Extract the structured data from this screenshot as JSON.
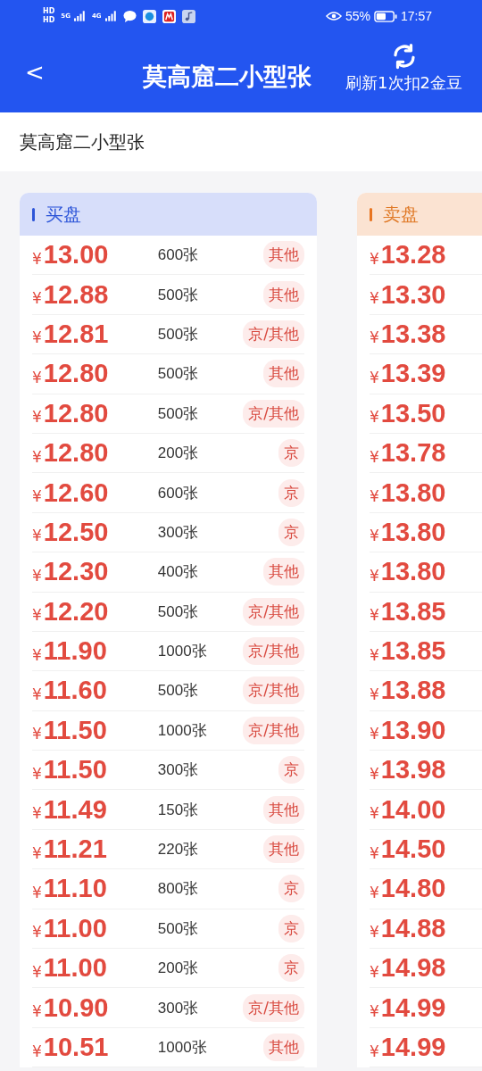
{
  "status_bar": {
    "sim_labels": [
      "HD",
      "HD"
    ],
    "networks": [
      "5G",
      "4G"
    ],
    "battery_text": "55%",
    "time": "17:57"
  },
  "header": {
    "back": "<",
    "title": "莫高窟二小型张",
    "refresh_note": "刷新1次扣2金豆"
  },
  "subtitle": "莫高窟二小型张",
  "buy": {
    "title": "买盘",
    "rows": [
      {
        "currency": "¥",
        "price": "13.00",
        "qty": "600张",
        "tag": "其他"
      },
      {
        "currency": "¥",
        "price": "12.88",
        "qty": "500张",
        "tag": "其他"
      },
      {
        "currency": "¥",
        "price": "12.81",
        "qty": "500张",
        "tag": "京/其他"
      },
      {
        "currency": "¥",
        "price": "12.80",
        "qty": "500张",
        "tag": "其他"
      },
      {
        "currency": "¥",
        "price": "12.80",
        "qty": "500张",
        "tag": "京/其他"
      },
      {
        "currency": "¥",
        "price": "12.80",
        "qty": "200张",
        "tag": "京"
      },
      {
        "currency": "¥",
        "price": "12.60",
        "qty": "600张",
        "tag": "京"
      },
      {
        "currency": "¥",
        "price": "12.50",
        "qty": "300张",
        "tag": "京"
      },
      {
        "currency": "¥",
        "price": "12.30",
        "qty": "400张",
        "tag": "其他"
      },
      {
        "currency": "¥",
        "price": "12.20",
        "qty": "500张",
        "tag": "京/其他"
      },
      {
        "currency": "¥",
        "price": "11.90",
        "qty": "1000张",
        "tag": "京/其他"
      },
      {
        "currency": "¥",
        "price": "11.60",
        "qty": "500张",
        "tag": "京/其他"
      },
      {
        "currency": "¥",
        "price": "11.50",
        "qty": "1000张",
        "tag": "京/其他"
      },
      {
        "currency": "¥",
        "price": "11.50",
        "qty": "300张",
        "tag": "京"
      },
      {
        "currency": "¥",
        "price": "11.49",
        "qty": "150张",
        "tag": "其他"
      },
      {
        "currency": "¥",
        "price": "11.21",
        "qty": "220张",
        "tag": "其他"
      },
      {
        "currency": "¥",
        "price": "11.10",
        "qty": "800张",
        "tag": "京"
      },
      {
        "currency": "¥",
        "price": "11.00",
        "qty": "500张",
        "tag": "京"
      },
      {
        "currency": "¥",
        "price": "11.00",
        "qty": "200张",
        "tag": "京"
      },
      {
        "currency": "¥",
        "price": "10.90",
        "qty": "300张",
        "tag": "京/其他"
      },
      {
        "currency": "¥",
        "price": "10.51",
        "qty": "1000张",
        "tag": "其他"
      }
    ]
  },
  "sell": {
    "title": "卖盘",
    "rows": [
      {
        "currency": "¥",
        "price": "13.28"
      },
      {
        "currency": "¥",
        "price": "13.30"
      },
      {
        "currency": "¥",
        "price": "13.38"
      },
      {
        "currency": "¥",
        "price": "13.39"
      },
      {
        "currency": "¥",
        "price": "13.50"
      },
      {
        "currency": "¥",
        "price": "13.78"
      },
      {
        "currency": "¥",
        "price": "13.80"
      },
      {
        "currency": "¥",
        "price": "13.80"
      },
      {
        "currency": "¥",
        "price": "13.80"
      },
      {
        "currency": "¥",
        "price": "13.85"
      },
      {
        "currency": "¥",
        "price": "13.85"
      },
      {
        "currency": "¥",
        "price": "13.88"
      },
      {
        "currency": "¥",
        "price": "13.90"
      },
      {
        "currency": "¥",
        "price": "13.98"
      },
      {
        "currency": "¥",
        "price": "14.00"
      },
      {
        "currency": "¥",
        "price": "14.50"
      },
      {
        "currency": "¥",
        "price": "14.80"
      },
      {
        "currency": "¥",
        "price": "14.88"
      },
      {
        "currency": "¥",
        "price": "14.98"
      },
      {
        "currency": "¥",
        "price": "14.99"
      },
      {
        "currency": "¥",
        "price": "14.99"
      }
    ]
  }
}
